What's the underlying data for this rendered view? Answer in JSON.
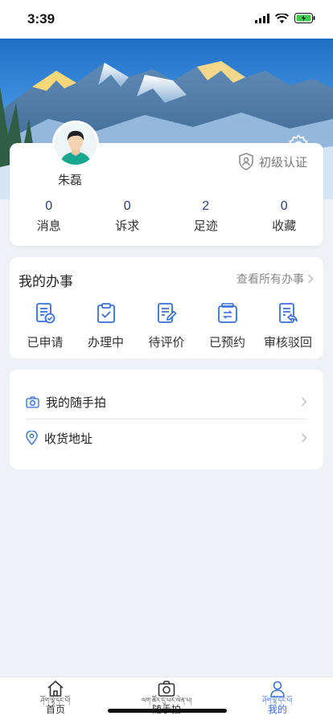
{
  "status_bar": {
    "time": "3:39"
  },
  "profile": {
    "name": "朱磊",
    "certification": "初级认证",
    "stats": [
      {
        "value": "0",
        "label": "消息"
      },
      {
        "value": "0",
        "label": "诉求"
      },
      {
        "value": "2",
        "label": "足迹"
      },
      {
        "value": "0",
        "label": "收藏"
      }
    ]
  },
  "affairs": {
    "title": "我的办事",
    "more_label": "查看所有办事",
    "items": [
      {
        "label": "已申请",
        "icon": "applied-icon"
      },
      {
        "label": "办理中",
        "icon": "processing-icon"
      },
      {
        "label": "待评价",
        "icon": "to-evaluate-icon"
      },
      {
        "label": "已预约",
        "icon": "reserved-icon"
      },
      {
        "label": "审核驳回",
        "icon": "rejected-icon"
      }
    ]
  },
  "links": [
    {
      "label": "我的随手拍",
      "icon": "camera-icon"
    },
    {
      "label": "收货地址",
      "icon": "location-icon"
    }
  ],
  "tab_bar": {
    "tabs": [
      {
        "tibetan": "ཤོག་ལྷེ་དང་པོ།",
        "label": "首页",
        "icon": "home-icon"
      },
      {
        "tibetan": "ལག་ཚོར་དུ་པར་ལེན་པ།",
        "label": "随手拍",
        "icon": "camera-icon"
      },
      {
        "tibetan": "ཤོག་ལྷེ་དང་པོ།",
        "label": "我的",
        "icon": "user-icon"
      }
    ],
    "active": "我的"
  },
  "colors": {
    "accent": "#3a6fd8",
    "stat_number": "#2a3d7a",
    "page_bg": "#eef1f5"
  }
}
